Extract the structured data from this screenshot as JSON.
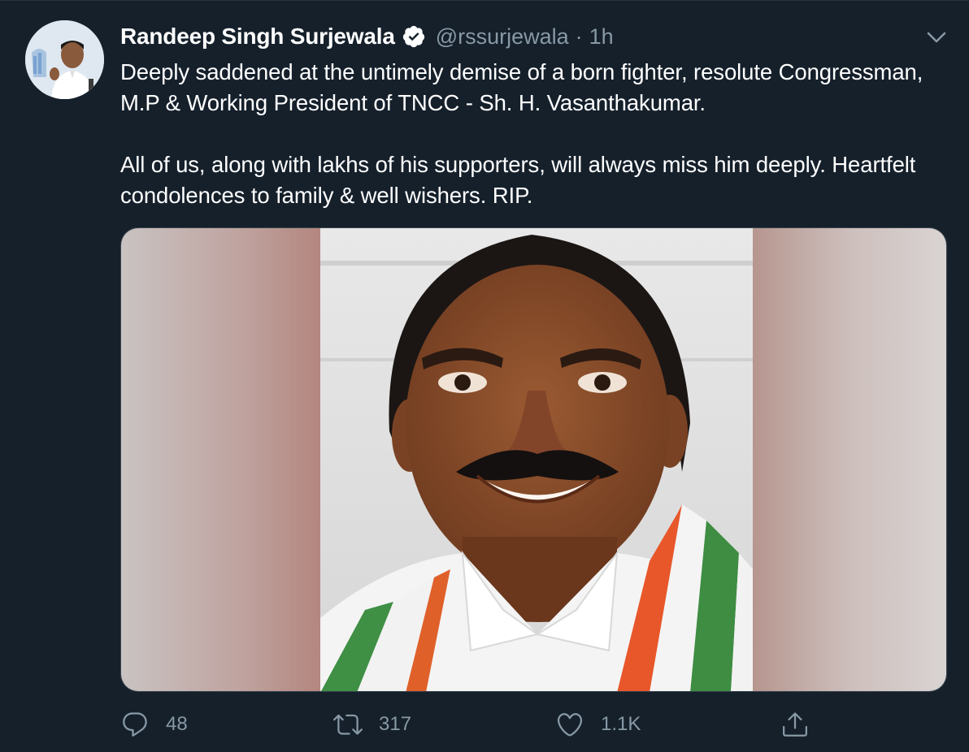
{
  "tweet": {
    "author_name": "Randeep Singh Surjewala",
    "handle": "@rssurjewala",
    "separator": "·",
    "time": "1h",
    "paragraphs": [
      "Deeply saddened at the untimely demise of a born fighter, resolute Congressman, M.P & Working President of TNCC - Sh. H. Vasanthakumar.",
      "All of us, along with lakhs of his supporters, will always miss him deeply. Heartfelt condolences to family & well wishers. RIP."
    ]
  },
  "actions": {
    "reply_count": "48",
    "retweet_count": "317",
    "like_count": "1.1K"
  },
  "colors": {
    "background": "#15202b",
    "text_primary": "#ffffff",
    "text_secondary": "#8899a6",
    "border": "#38444d"
  },
  "icons": {
    "verified": "verified-badge-icon",
    "menu": "chevron-down-icon",
    "reply": "reply-icon",
    "retweet": "retweet-icon",
    "like": "heart-icon",
    "share": "share-icon"
  }
}
